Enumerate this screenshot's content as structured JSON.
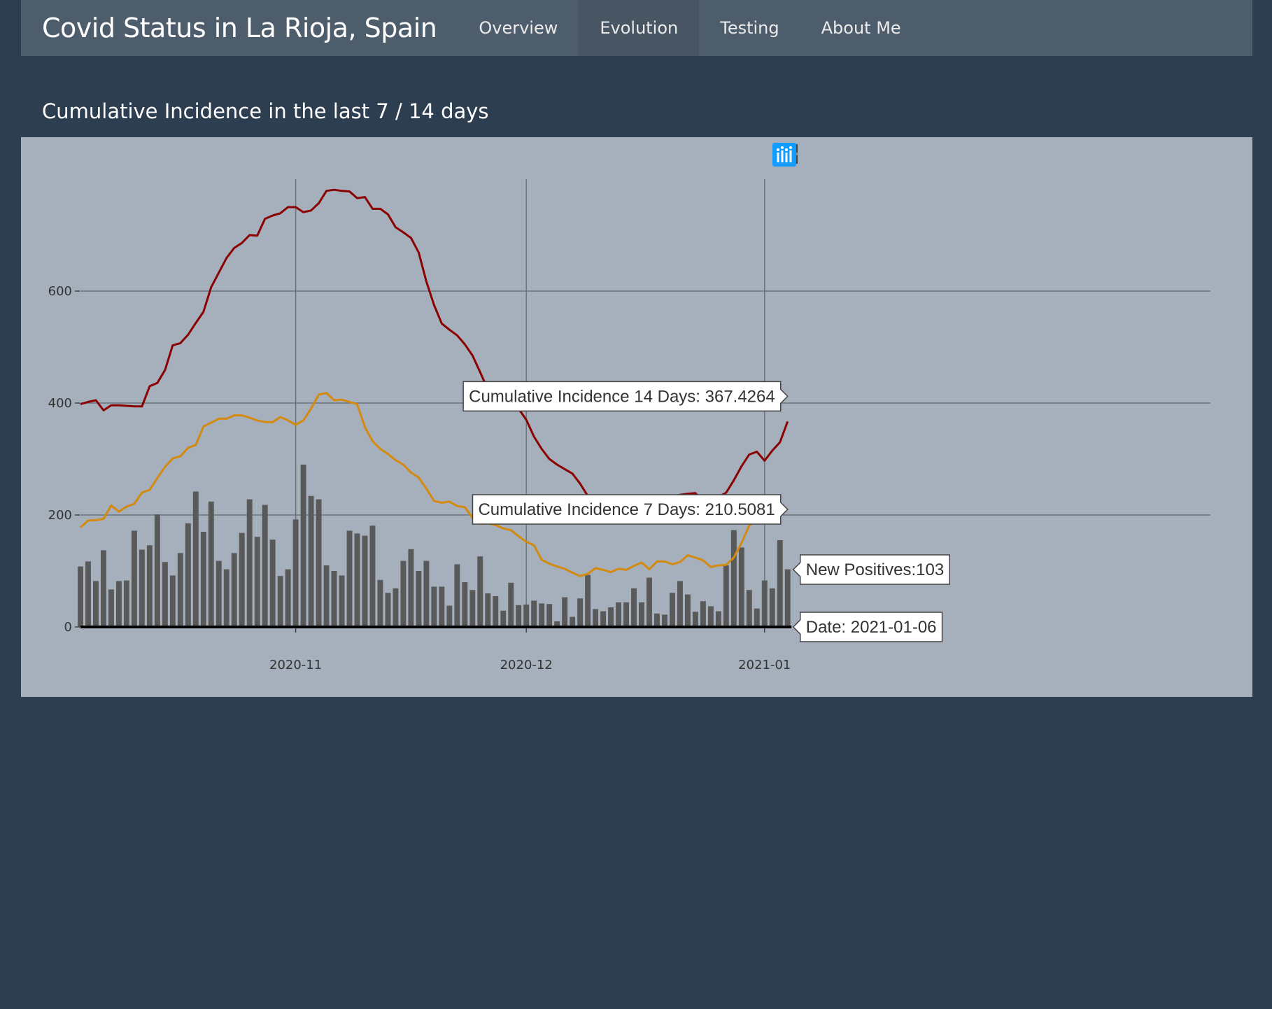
{
  "navbar": {
    "brand": "Covid Status in La Rioja, Spain",
    "items": [
      {
        "label": "Overview",
        "active": false
      },
      {
        "label": "Evolution",
        "active": true
      },
      {
        "label": "Testing",
        "active": false
      },
      {
        "label": "About Me",
        "active": false
      }
    ]
  },
  "section": {
    "title": "Cumulative Incidence in the last 7 / 14 days"
  },
  "modebar": {
    "icons": [
      "camera-icon",
      "zoom-icon",
      "pan-icon",
      "box-select-icon",
      "lasso-icon",
      "zoom-in-icon",
      "zoom-out-icon",
      "autoscale-icon",
      "reset-axes-icon",
      "spike-lines-icon",
      "hover-closest-icon",
      "hover-compare-icon",
      "plotly-logo-icon"
    ]
  },
  "colors": {
    "background": "#2c3e50",
    "navbar": "#4e5d6c",
    "plot_bg": "#a5b0bc",
    "ci14": "#8b0000",
    "ci7": "#d4890f",
    "bars": "#595959"
  },
  "chart_data": {
    "type": "bar+line",
    "x_start": "2020-10-04",
    "x_end": "2021-01-06",
    "xlim": [
      "2020-10-04",
      "2021-02-28"
    ],
    "ylim": [
      0,
      800
    ],
    "y_ticks": [
      0,
      200,
      400,
      600
    ],
    "x_ticks": [
      "2020-11",
      "2020-12",
      "2021-01"
    ],
    "x_tick_dates": [
      "2020-11-01",
      "2020-12-01",
      "2021-01-01"
    ],
    "grid": true,
    "legend": "none",
    "series": [
      {
        "name": "New Positives",
        "kind": "bar",
        "color": "#595959",
        "values": [
          108,
          117,
          82,
          137,
          67,
          82,
          83,
          172,
          138,
          146,
          201,
          116,
          92,
          132,
          185,
          242,
          170,
          224,
          118,
          103,
          132,
          168,
          228,
          161,
          218,
          156,
          91,
          103,
          192,
          290,
          234,
          228,
          110,
          100,
          92,
          172,
          167,
          163,
          181,
          84,
          61,
          69,
          118,
          139,
          100,
          118,
          72,
          72,
          38,
          112,
          80,
          66,
          126,
          60,
          55,
          29,
          79,
          39,
          40,
          47,
          42,
          41,
          10,
          53,
          18,
          51,
          93,
          32,
          28,
          35,
          44,
          44,
          69,
          44,
          88,
          24,
          22,
          61,
          82,
          58,
          27,
          46,
          37,
          28,
          110,
          173,
          142,
          66,
          33,
          83,
          69,
          155,
          103
        ]
      },
      {
        "name": "Cumulative Incidence 14 Days",
        "kind": "line",
        "color": "#8b0000",
        "values": [
          398,
          402,
          405,
          387,
          396,
          396,
          395,
          394,
          394,
          430,
          436,
          459,
          503,
          507,
          522,
          543,
          563,
          607,
          633,
          659,
          677,
          686,
          700,
          699,
          729,
          735,
          739,
          750,
          750,
          741,
          744,
          757,
          779,
          781,
          779,
          778,
          766,
          768,
          747,
          747,
          737,
          714,
          705,
          695,
          669,
          617,
          575,
          542,
          531,
          521,
          505,
          485,
          455,
          424,
          411,
          404,
          402,
          390,
          370,
          340,
          318,
          300,
          290,
          282,
          274,
          256,
          234,
          218,
          210,
          205,
          208,
          212,
          215,
          220,
          224,
          228,
          230,
          233,
          236,
          238,
          239,
          225,
          226,
          232,
          240,
          262,
          287,
          308,
          313,
          297,
          315,
          330,
          367
        ]
      },
      {
        "name": "Cumulative Incidence 7 Days",
        "kind": "line",
        "color": "#d4890f",
        "values": [
          178,
          190,
          191,
          193,
          217,
          206,
          215,
          220,
          240,
          245,
          266,
          286,
          301,
          305,
          320,
          325,
          358,
          365,
          372,
          372,
          378,
          378,
          374,
          369,
          366,
          366,
          375,
          369,
          361,
          369,
          390,
          415,
          418,
          405,
          406,
          402,
          398,
          357,
          332,
          318,
          309,
          298,
          290,
          276,
          267,
          247,
          225,
          222,
          224,
          216,
          214,
          195,
          184,
          185,
          182,
          176,
          173,
          162,
          152,
          146,
          120,
          113,
          108,
          104,
          97,
          91,
          95,
          105,
          102,
          98,
          104,
          102,
          109,
          115,
          103,
          117,
          117,
          112,
          116,
          128,
          124,
          119,
          107,
          110,
          111,
          124,
          150,
          181,
          193,
          210,
          212,
          210,
          210
        ]
      }
    ],
    "hover_labels": [
      {
        "text": "Cumulative Incidence 14 Days: 367.4264",
        "series": "ci14"
      },
      {
        "text": "Cumulative Incidence 7 Days: 210.5081",
        "series": "ci7"
      },
      {
        "text": "New Positives:103",
        "series": "bars"
      },
      {
        "text": "Date: 2021-01-06",
        "series": "date"
      }
    ]
  }
}
